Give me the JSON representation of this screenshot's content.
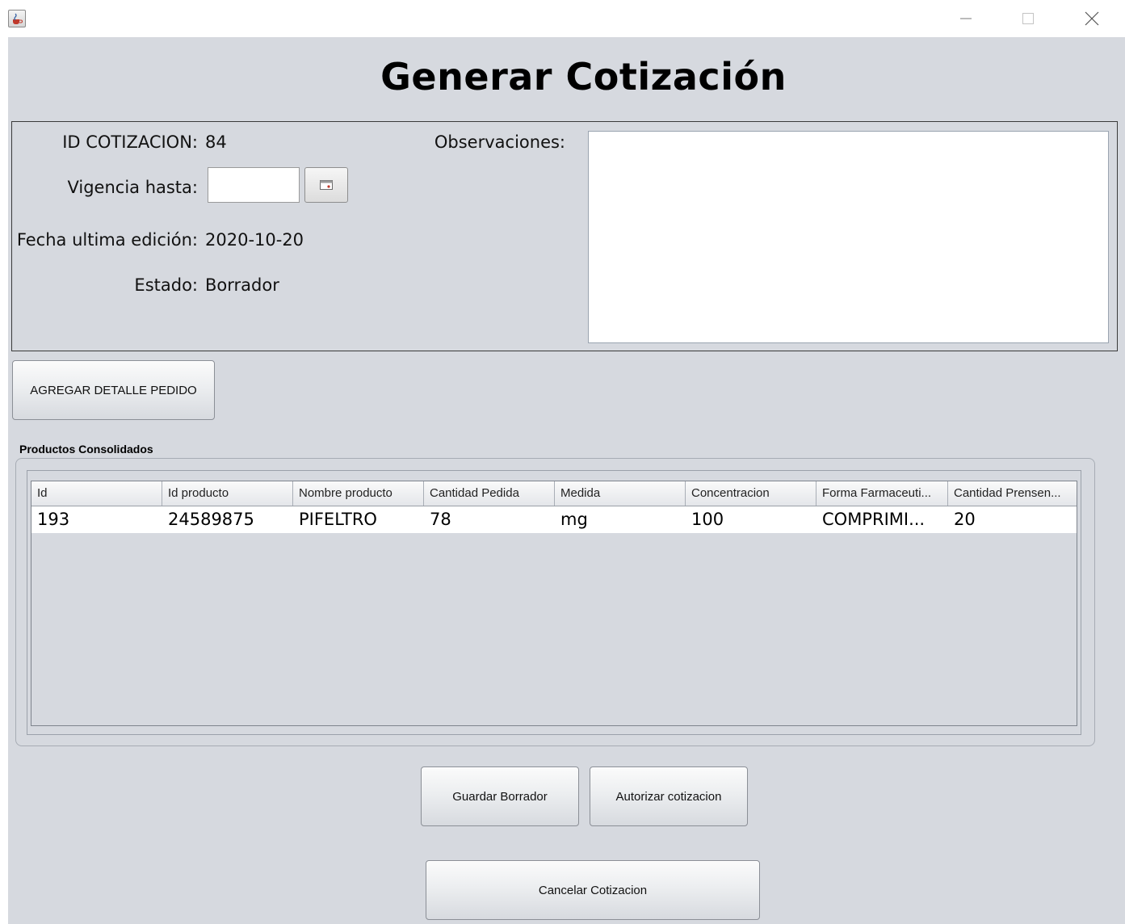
{
  "window": {
    "app_icon": "java-cup-icon",
    "controls": [
      "minimize-icon",
      "maximize-icon",
      "close-icon"
    ]
  },
  "page": {
    "title": "Generar Cotización"
  },
  "info": {
    "id_label": "ID COTIZACION:",
    "id_value": "84",
    "vigencia_label": "Vigencia hasta:",
    "vigencia_value": "",
    "fecha_label": "Fecha ultima edición:",
    "fecha_value": "2020-10-20",
    "estado_label": "Estado:",
    "estado_value": "Borrador",
    "observaciones_label": "Observaciones:",
    "observaciones_value": ""
  },
  "buttons": {
    "agregar": "AGREGAR DETALLE PEDIDO",
    "guardar": "Guardar Borrador",
    "autorizar": "Autorizar cotizacion",
    "cancelar": "Cancelar Cotizacion"
  },
  "table": {
    "group_title": "Productos Consolidados",
    "columns": [
      "Id",
      "Id producto",
      "Nombre producto",
      "Cantidad Pedida",
      "Medida",
      "Concentracion",
      "Forma Farmaceuti...",
      "Cantidad Prensen..."
    ],
    "rows": [
      [
        "193",
        "24589875",
        "PIFELTRO",
        "78",
        "mg",
        "100",
        "COMPRIMI...",
        "20"
      ]
    ]
  },
  "colors": {
    "background": "#d6d9df",
    "row_background": "#ffffff"
  }
}
